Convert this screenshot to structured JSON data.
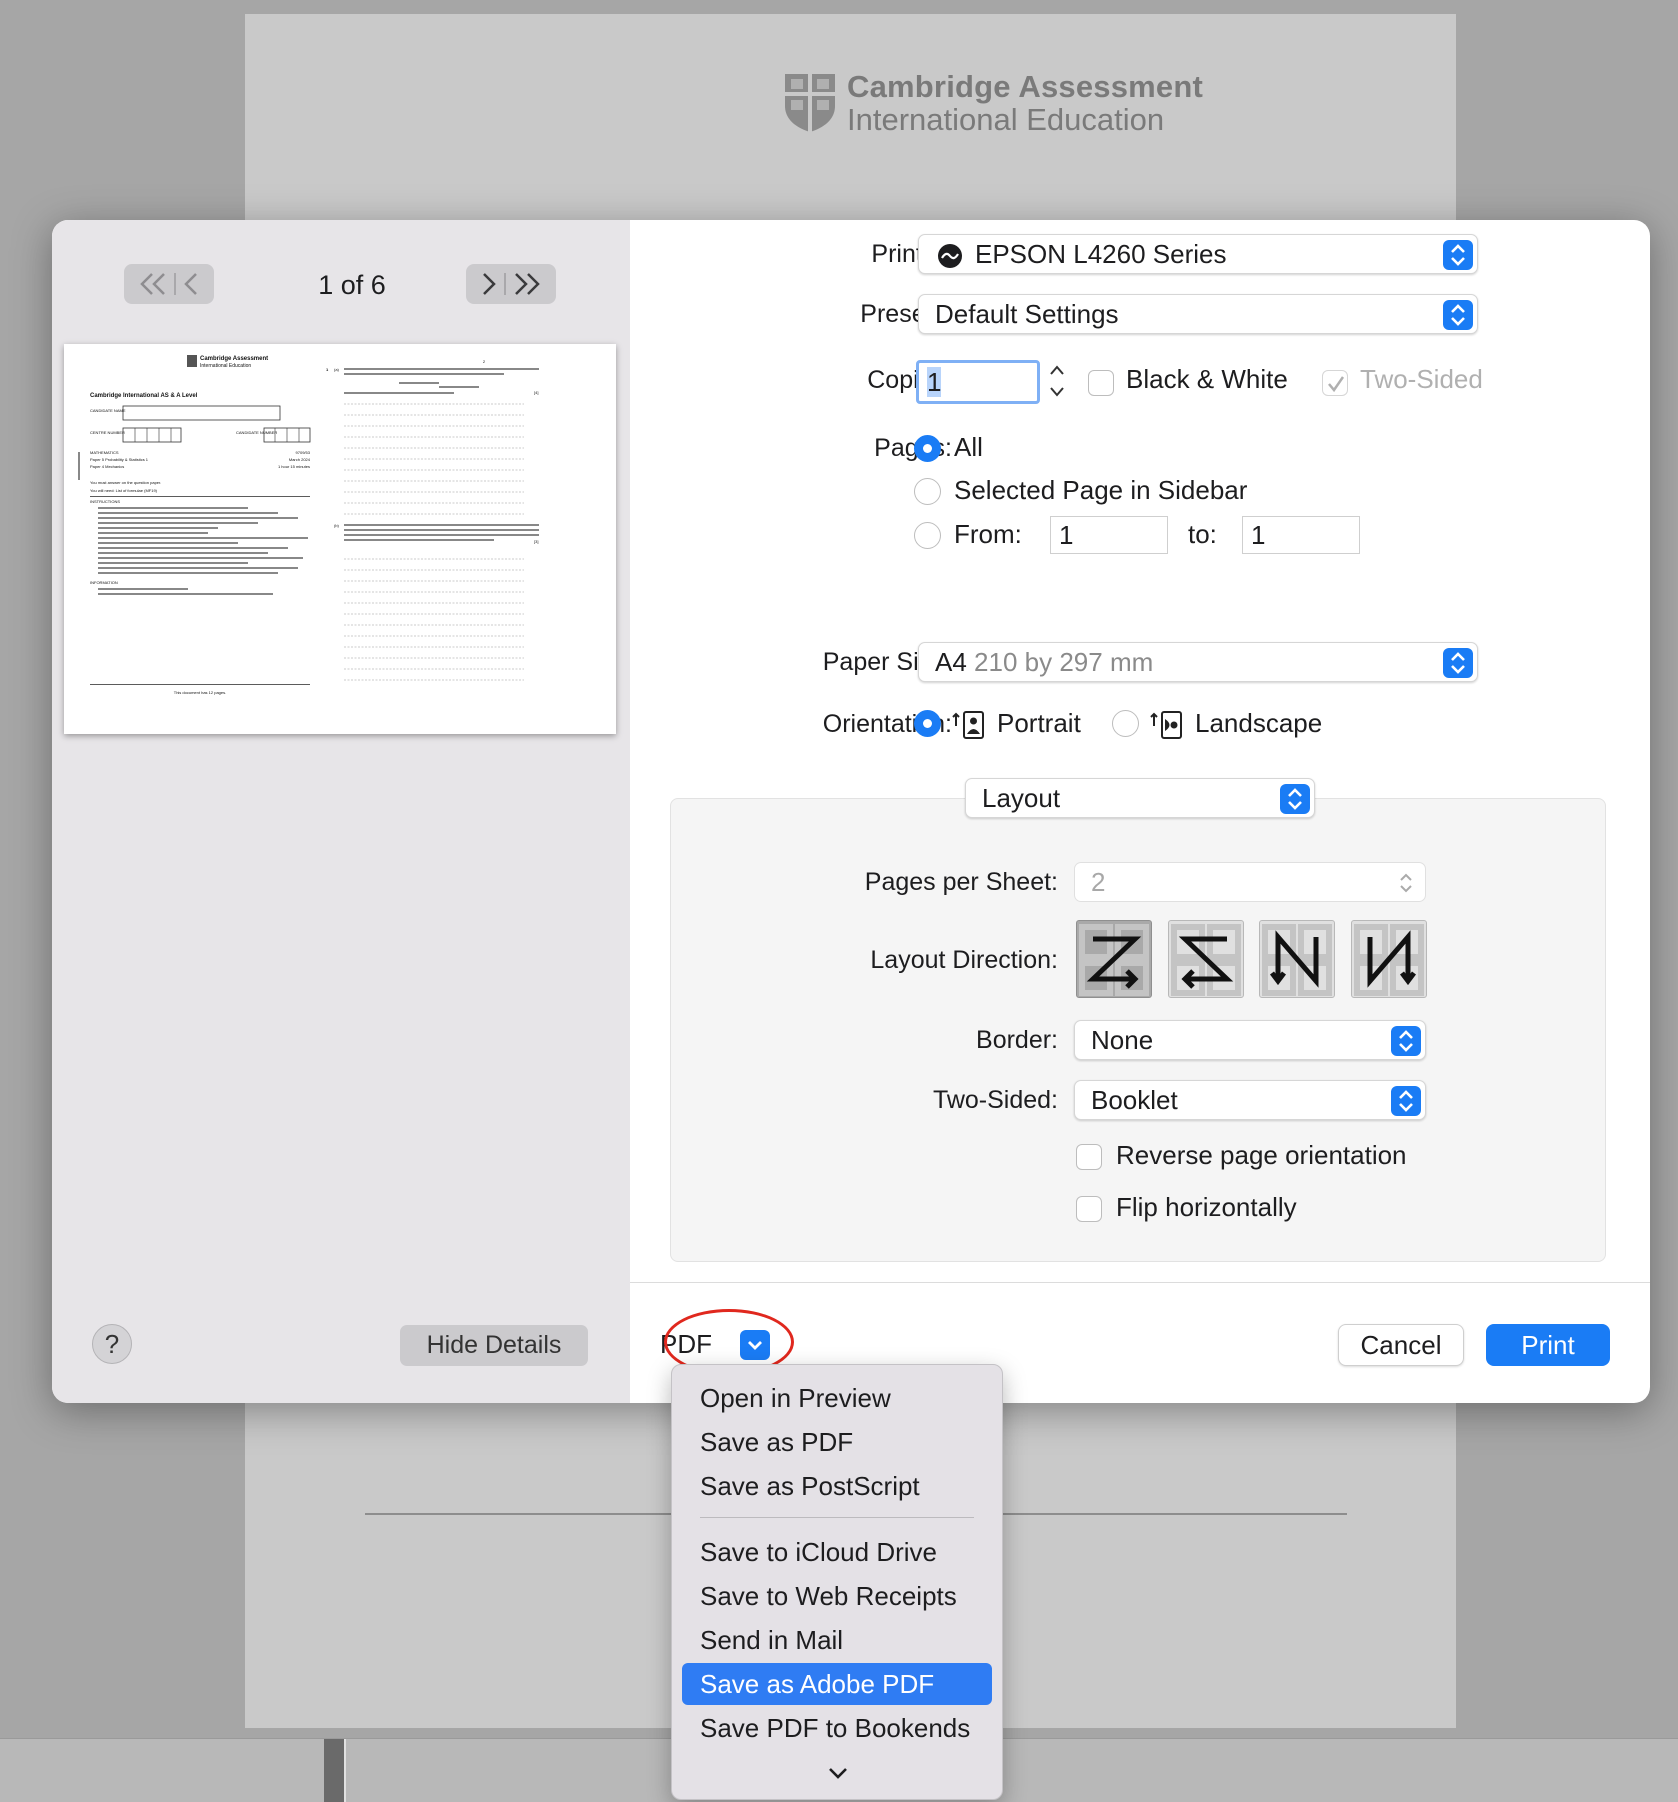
{
  "background": {
    "logo_line1": "Cambridge Assessment",
    "logo_line2": "International Education"
  },
  "sidebar": {
    "page_counter": "1 of 6",
    "help_label": "?",
    "hide_details_label": "Hide Details",
    "thumbnail": {
      "logo": "Cambridge Assessment",
      "logo_sub": "International Education",
      "heading": "Cambridge International AS & A Level",
      "candidate_name": "CANDIDATE NAME",
      "centre_number": "CENTRE NUMBER",
      "candidate_number": "CANDIDATE NUMBER",
      "subject": "MATHEMATICS",
      "code": "9709/53",
      "paper1": "Paper 5 Probability & Statistics 1",
      "date": "March 2024",
      "paper2": "Paper 4 Mechanics",
      "duration": "1 hour 15 minutes",
      "answer_line": "You must answer on the question paper.",
      "need_line": "You will need:  List of formulae (MF19)",
      "instructions": "INSTRUCTIONS",
      "information": "INFORMATION",
      "footer": "This document has 12 pages.",
      "page_no": "2",
      "q1_num": "1",
      "q1_part": "(a)",
      "q1_mark": "[4]",
      "q1b_part": "(b)",
      "q1b_mark": "[3]"
    }
  },
  "form": {
    "printer_label": "Printer:",
    "printer_value": "EPSON L4260 Series",
    "presets_label": "Presets:",
    "presets_value": "Default Settings",
    "copies_label": "Copies:",
    "copies_value": "1",
    "bw_label": "Black & White",
    "two_sided_label": "Two-Sided",
    "pages_label": "Pages:",
    "pages_all": "All",
    "pages_selected": "Selected Page in Sidebar",
    "pages_from": "From:",
    "from_value": "1",
    "pages_to": "to:",
    "to_value": "1",
    "paper_size_label": "Paper Size:",
    "paper_size_main": "A4",
    "paper_size_detail": "210 by 297 mm",
    "orientation_label": "Orientation:",
    "portrait": "Portrait",
    "landscape": "Landscape"
  },
  "layout": {
    "section_value": "Layout",
    "pages_per_sheet_label": "Pages per Sheet:",
    "pages_per_sheet_value": "2",
    "layout_direction_label": "Layout Direction:",
    "border_label": "Border:",
    "border_value": "None",
    "two_sided_label": "Two-Sided:",
    "two_sided_value": "Booklet",
    "reverse_label": "Reverse page orientation",
    "flip_label": "Flip horizontally"
  },
  "footer": {
    "pdf_label": "PDF",
    "cancel_label": "Cancel",
    "print_label": "Print"
  },
  "pdf_menu": {
    "items_top": [
      "Open in Preview",
      "Save as PDF",
      "Save as PostScript"
    ],
    "items_bottom": [
      "Save to iCloud Drive",
      "Save to Web Receipts",
      "Send in Mail",
      "Save as Adobe PDF",
      "Save PDF to Bookends"
    ],
    "highlighted": "Save as Adobe PDF"
  },
  "colors": {
    "accent": "#1a7cf5",
    "annotation_ring": "#e0281e",
    "menu_highlight": "#2f7cf3"
  },
  "icons": [
    "double-chevron-left-icon",
    "chevron-left-icon",
    "chevron-right-icon",
    "double-chevron-right-icon",
    "printer-status-icon",
    "up-down-arrows-icon",
    "portrait-icon",
    "landscape-icon",
    "chevron-down-icon",
    "shield-icon"
  ]
}
